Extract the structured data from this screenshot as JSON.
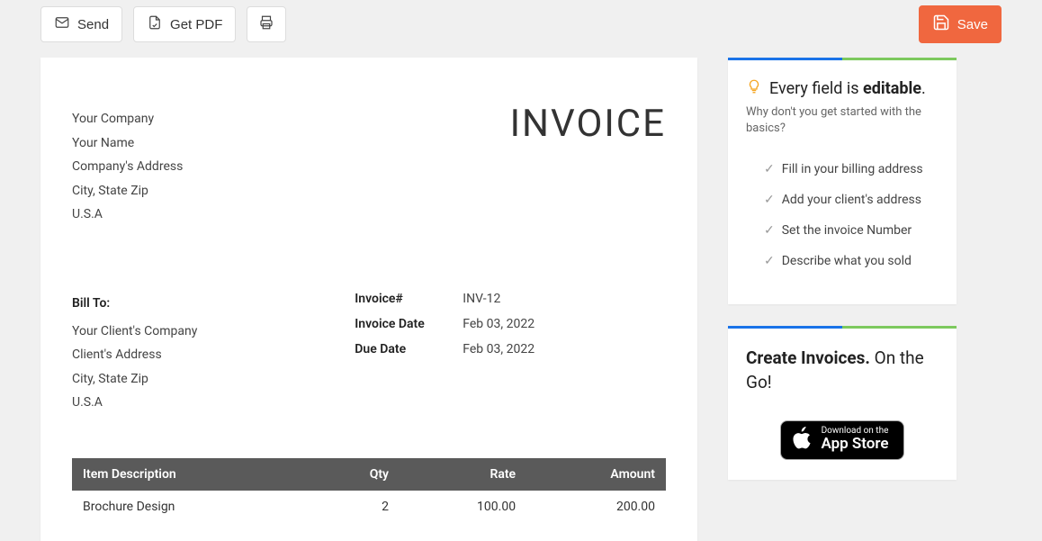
{
  "toolbar": {
    "send_label": "Send",
    "get_pdf_label": "Get PDF",
    "save_label": "Save"
  },
  "invoice": {
    "title": "INVOICE",
    "from": {
      "company": "Your Company",
      "name": "Your Name",
      "address": "Company's Address",
      "city_state_zip": "City, State Zip",
      "country": "U.S.A"
    },
    "bill_to_label": "Bill To:",
    "bill_to": {
      "company": "Your Client's Company",
      "address": "Client's Address",
      "city_state_zip": "City, State Zip",
      "country": "U.S.A"
    },
    "meta": {
      "number_label": "Invoice#",
      "number": "INV-12",
      "date_label": "Invoice Date",
      "date": "Feb 03, 2022",
      "due_label": "Due Date",
      "due": "Feb 03, 2022"
    },
    "columns": {
      "desc": "Item Description",
      "qty": "Qty",
      "rate": "Rate",
      "amount": "Amount"
    },
    "items": [
      {
        "desc": "Brochure Design",
        "qty": "2",
        "rate": "100.00",
        "amount": "200.00"
      }
    ]
  },
  "tip": {
    "heading_pre": "Every field is ",
    "heading_strong": "editable",
    "heading_post": ".",
    "sub": "Why don't you get started with the basics?",
    "items": [
      "Fill in your billing address",
      "Add your client's address",
      "Set the invoice Number",
      "Describe what you sold"
    ]
  },
  "promo": {
    "title_strong": "Create Invoices.",
    "title_rest": " On the Go!",
    "appstore_small": "Download on the",
    "appstore_big": "App Store"
  }
}
